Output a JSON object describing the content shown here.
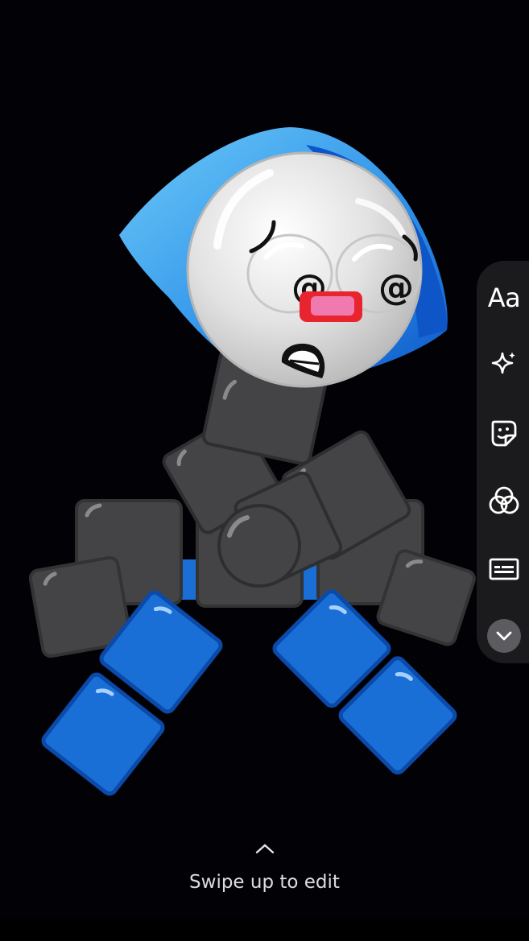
{
  "editor": {
    "swipe_hint": "Swipe up to edit",
    "tools": [
      {
        "id": "text",
        "label": "Aa",
        "icon": "text-icon"
      },
      {
        "id": "effects",
        "icon": "sparkle-icon"
      },
      {
        "id": "sticker",
        "icon": "sticker-icon"
      },
      {
        "id": "filters",
        "icon": "filter-circles-icon"
      },
      {
        "id": "captions",
        "icon": "captions-icon"
      },
      {
        "id": "more",
        "icon": "chevron-down-icon"
      }
    ]
  },
  "colors": {
    "background": "#020206",
    "rail": "#1b1b1d",
    "character_blue": "#1a6fd6",
    "character_gray": "#444446",
    "face_white": "#e6e6e6",
    "nose_red": "#e8252f"
  }
}
